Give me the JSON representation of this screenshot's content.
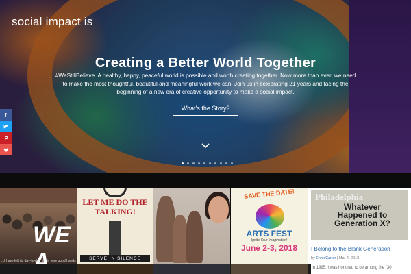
{
  "site": {
    "logo": "social impact is"
  },
  "hero": {
    "title": "Creating a Better World Together",
    "text": "#WeStillBelieve. A healthy, happy, peaceful world is possible and worth creating together. Now more than ever, we need to make the most thoughtful, beautiful and meaningful work we can. Join us in celebrating 21 years and facing the beginning of a new era of creative opportunity to make a social impact.",
    "cta_label": "What's the Story?",
    "slide_count": 10,
    "active_slide": 1
  },
  "social": [
    {
      "name": "facebook",
      "icon": "facebook-icon",
      "color": "#3b5998"
    },
    {
      "name": "twitter",
      "icon": "twitter-icon",
      "color": "#1da1f2"
    },
    {
      "name": "pinterest",
      "icon": "pinterest-icon",
      "color": "#cb2027"
    },
    {
      "name": "love",
      "icon": "heart-icon",
      "color": "#e9544f"
    }
  ],
  "tiles": {
    "t1": {
      "overlay": "WE A",
      "caption": "...I have left its day-to-day life in very good hands"
    },
    "t2": {
      "headline": "LET ME DO THE TALKING!",
      "footer": "SERVE IN SILENCE"
    },
    "t4": {
      "save": "SAVE THE DATE!",
      "event": "ARTS FEST",
      "tagline": "Ignite Your Imagination!",
      "dates": "June 2-3, 2018"
    },
    "t5": {
      "image_top": "Philadelphia",
      "image_headline": "Whatever Happened to Generation X?",
      "post_title": "I Belong to the Blank Generation",
      "author": "EnnisCarter",
      "date": "Mar 4, 2018",
      "excerpt": "In 1995, I was honored to be among the \"30"
    }
  }
}
